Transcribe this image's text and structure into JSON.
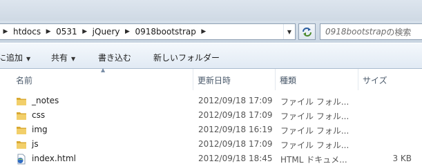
{
  "address": {
    "crumbs": [
      "htdocs",
      "0531",
      "jQuery",
      "0918bootstrap"
    ]
  },
  "search": {
    "placeholder_italic": "0918bootstrap",
    "placeholder_suffix": "の検索"
  },
  "toolbar": {
    "add_label": "に追加",
    "share_label": "共有",
    "burn_label": "書き込む",
    "new_folder_label": "新しいフォルダー"
  },
  "columns": {
    "name": "名前",
    "modified": "更新日時",
    "type": "種類",
    "size": "サイズ"
  },
  "files": [
    {
      "name": "_notes",
      "modified": "2012/09/18 17:09",
      "type": "ファイル フォル...",
      "size": "",
      "icon": "folder-icon"
    },
    {
      "name": "css",
      "modified": "2012/09/18 17:09",
      "type": "ファイル フォル...",
      "size": "",
      "icon": "folder-icon"
    },
    {
      "name": "img",
      "modified": "2012/09/18 16:19",
      "type": "ファイル フォル...",
      "size": "",
      "icon": "folder-icon"
    },
    {
      "name": "js",
      "modified": "2012/09/18 17:09",
      "type": "ファイル フォル...",
      "size": "",
      "icon": "folder-icon"
    },
    {
      "name": "index.html",
      "modified": "2012/09/18 18:45",
      "type": "HTML ドキュメ...",
      "size": "3 KB",
      "icon": "html-file-icon"
    }
  ],
  "colors": {
    "folder": "#e8c25a",
    "accent": "#2a5d9f"
  }
}
